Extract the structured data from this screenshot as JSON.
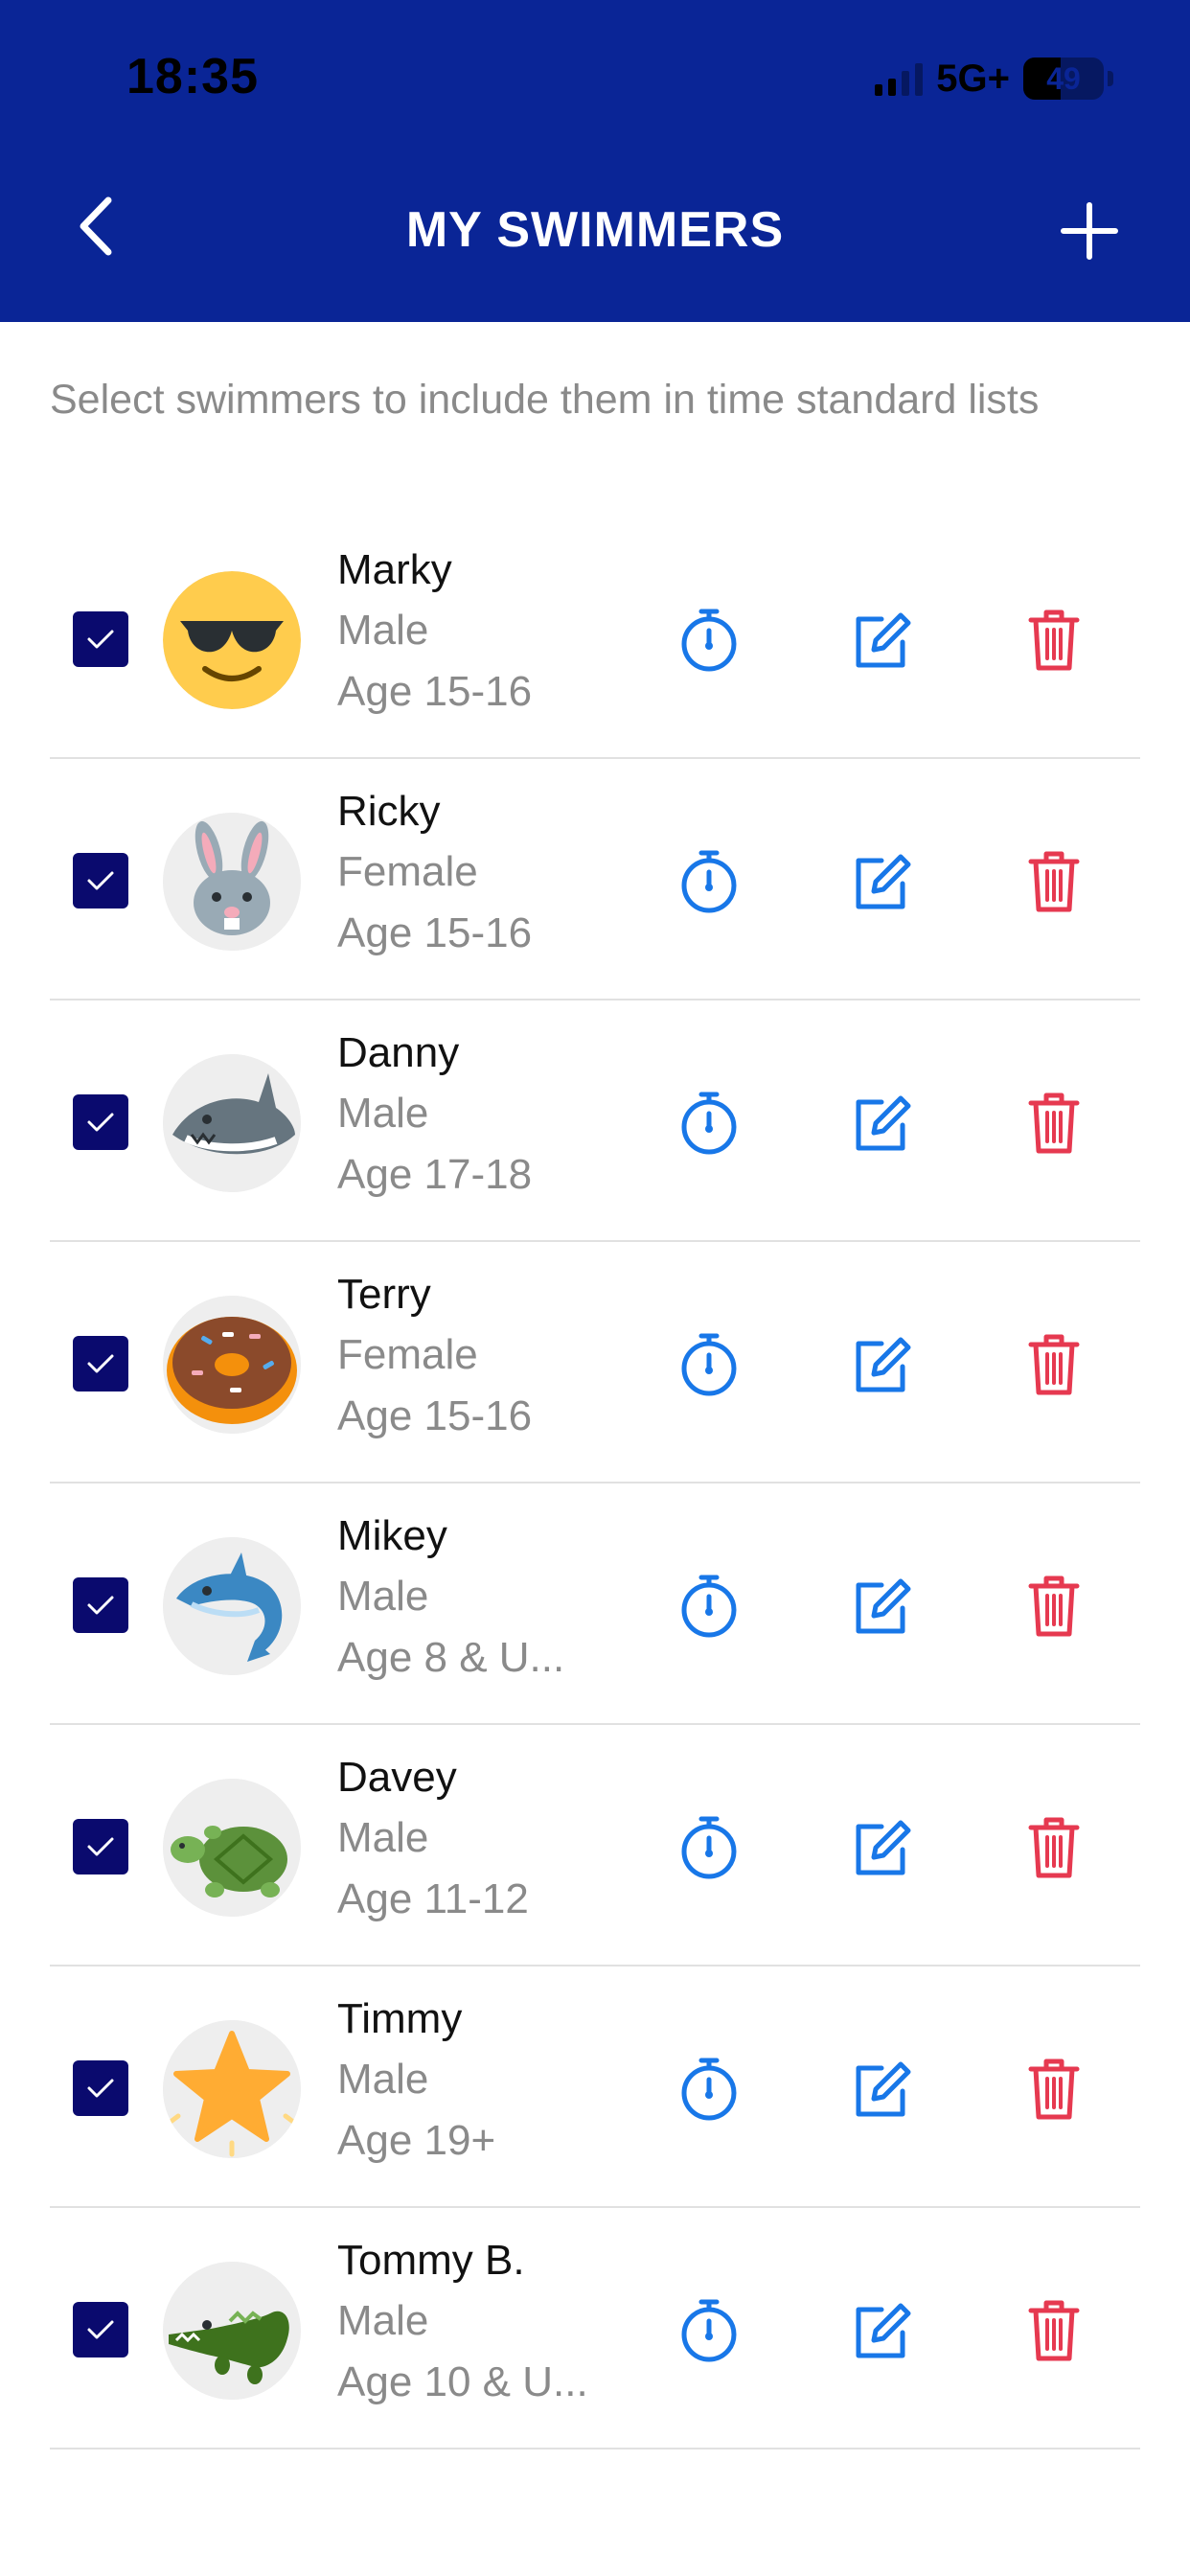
{
  "status_bar": {
    "time": "18:35",
    "network": "5G+",
    "battery": "49"
  },
  "header": {
    "title": "MY SWIMMERS"
  },
  "instructions": "Select swimmers to include them in time standard lists",
  "colors": {
    "header_bg": "#0A2596",
    "checkbox": "#0A0A6E",
    "action_blue": "#1877E8",
    "delete_red": "#E63950"
  },
  "swimmers": [
    {
      "name": "Marky",
      "gender": "Male",
      "age": "Age 15-16",
      "avatar": "sunglasses-face-icon",
      "checked": true
    },
    {
      "name": "Ricky",
      "gender": "Female",
      "age": "Age 15-16",
      "avatar": "rabbit-icon",
      "checked": true
    },
    {
      "name": "Danny",
      "gender": "Male",
      "age": "Age 17-18",
      "avatar": "shark-icon",
      "checked": true
    },
    {
      "name": "Terry",
      "gender": "Female",
      "age": "Age 15-16",
      "avatar": "donut-icon",
      "checked": true
    },
    {
      "name": "Mikey",
      "gender": "Male",
      "age": "Age 8 & U...",
      "avatar": "dolphin-icon",
      "checked": true
    },
    {
      "name": "Davey",
      "gender": "Male",
      "age": "Age 11-12",
      "avatar": "turtle-icon",
      "checked": true
    },
    {
      "name": "Timmy",
      "gender": "Male",
      "age": "Age 19+",
      "avatar": "star-icon",
      "checked": true
    },
    {
      "name": "Tommy B.",
      "gender": "Male",
      "age": "Age 10 & U...",
      "avatar": "crocodile-icon",
      "checked": true
    }
  ]
}
